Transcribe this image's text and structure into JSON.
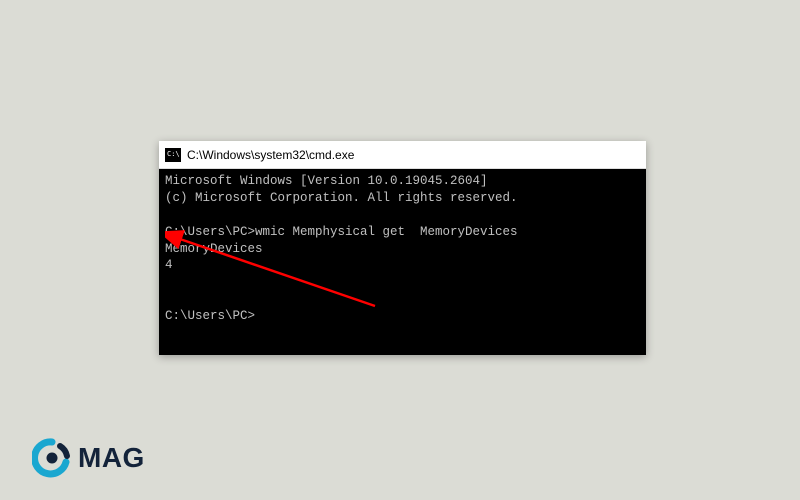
{
  "window": {
    "icon_label": "C:\\",
    "title": "C:\\Windows\\system32\\cmd.exe"
  },
  "terminal": {
    "line1": "Microsoft Windows [Version 10.0.19045.2604]",
    "line2": "(c) Microsoft Corporation. All rights reserved.",
    "blank1": "",
    "prompt1_prefix": "C:\\Users\\PC>",
    "prompt1_command": "wmic Memphysical get  MemoryDevices",
    "output_header": "MemoryDevices",
    "output_value": "4",
    "blank2": "",
    "blank3": "",
    "prompt2_prefix": "C:\\Users\\PC>",
    "prompt2_command": ""
  },
  "annotation": {
    "arrow_color": "#ff0000"
  },
  "branding": {
    "logo_text": "MAG",
    "logo_accent": "#1aa7d0",
    "logo_dark": "#13233a"
  }
}
